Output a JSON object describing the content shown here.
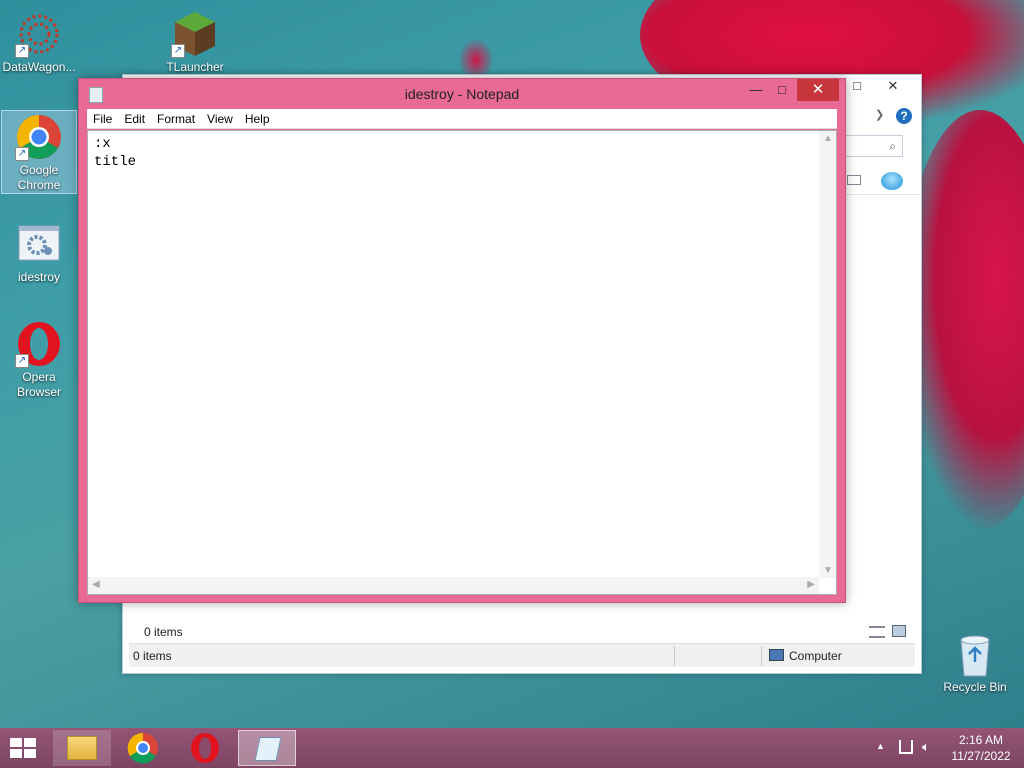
{
  "desktop": {
    "icons": [
      {
        "label": "DataWagon..."
      },
      {
        "label": "TLauncher"
      },
      {
        "label": "Google Chrome"
      },
      {
        "label": "idestroy"
      },
      {
        "label": "Opera Browser"
      },
      {
        "label": "Recycle Bin"
      }
    ]
  },
  "explorer": {
    "status_items_top": "0 items",
    "status_items": "0 items",
    "status_location": "Computer"
  },
  "notepad": {
    "title": "idestroy - Notepad",
    "menu": [
      "File",
      "Edit",
      "Format",
      "View",
      "Help"
    ],
    "content": ":x\ntitle",
    "minimize": "—",
    "maximize": "□",
    "close": "✕"
  },
  "taskbar": {
    "time": "2:16 AM",
    "date": "11/27/2022"
  },
  "colors": {
    "notepad_frame": "#e86a95",
    "taskbar": "#8a4c6a",
    "close_button": "#c7363c"
  }
}
